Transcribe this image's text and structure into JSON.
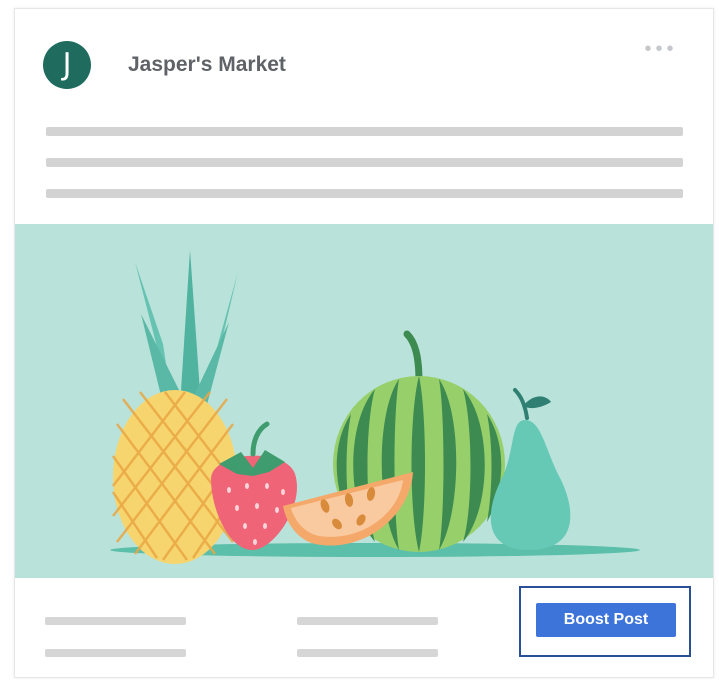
{
  "post": {
    "author": {
      "name": "Jasper's Market",
      "avatar_letter": "J",
      "avatar_color": "#1f6b5e"
    },
    "menu_icon": "more-horizontal-icon",
    "menu_glyph": "•••",
    "text_placeholder_lines": 3,
    "image": {
      "background_color": "#b9e3da",
      "icons": [
        "pineapple-icon",
        "strawberry-icon",
        "melon-slice-icon",
        "watermelon-icon",
        "pear-icon"
      ]
    },
    "actions": {
      "boost_label": "Boost Post",
      "boost_color": "#3d74da",
      "highlight_color": "#2a4f96"
    }
  }
}
